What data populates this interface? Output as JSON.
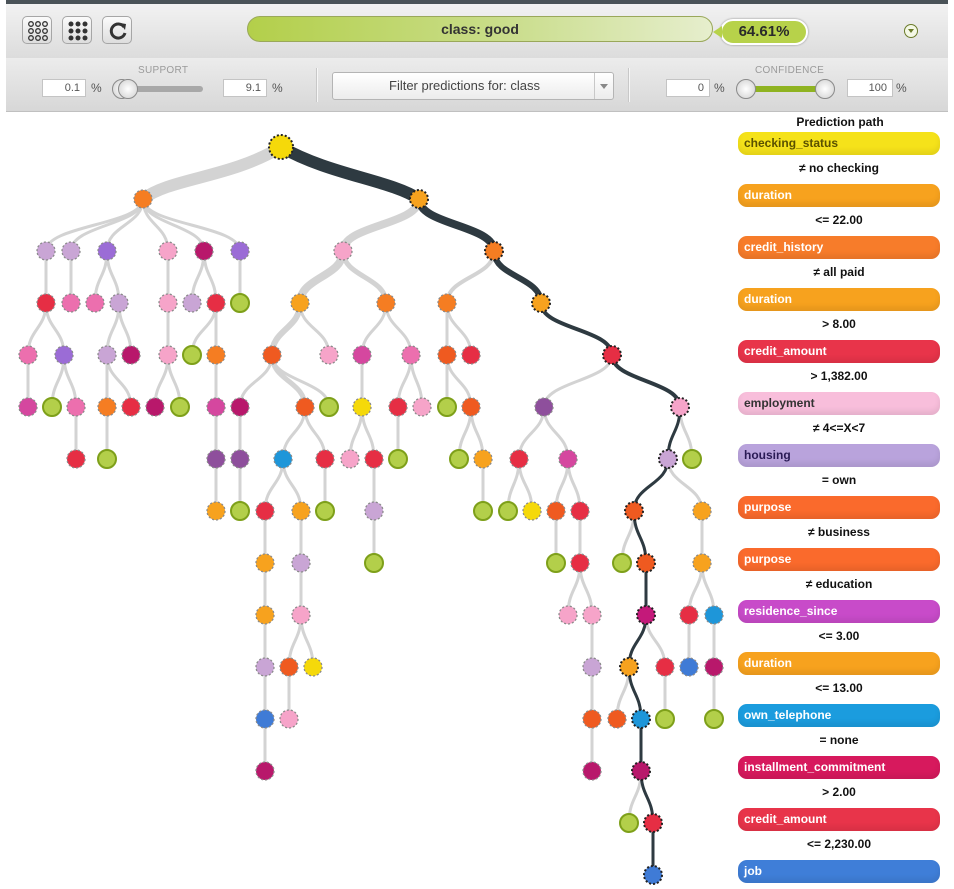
{
  "toolbar": {
    "prediction_label": "class: good",
    "confidence_value": "64.61%"
  },
  "controls": {
    "support_label": "SUPPORT",
    "support_min": "0.1",
    "support_max": "9.1",
    "support_unit": "%",
    "filter_label": "Filter predictions for: class",
    "confidence_label": "CONFIDENCE",
    "confidence_min": "0",
    "confidence_max": "100",
    "confidence_unit": "%"
  },
  "path_panel": {
    "title": "Prediction path",
    "steps": [
      {
        "field": "checking_status",
        "color": "#f5e21a",
        "text_color": "#5a5100"
      },
      {
        "condition": "≠ no checking"
      },
      {
        "field": "duration",
        "color": "#f7a21e",
        "text_color": "#ffffff"
      },
      {
        "condition": "<= 22.00"
      },
      {
        "field": "credit_history",
        "color": "#f77c2a",
        "text_color": "#ffffff"
      },
      {
        "condition": "≠ all paid"
      },
      {
        "field": "duration",
        "color": "#f7a21e",
        "text_color": "#ffffff"
      },
      {
        "condition": "> 8.00"
      },
      {
        "field": "credit_amount",
        "color": "#e8344a",
        "text_color": "#ffffff"
      },
      {
        "condition": "> 1,382.00"
      },
      {
        "field": "employment",
        "color": "#f8bedb",
        "text_color": "#333333"
      },
      {
        "condition": "≠ 4<=X<7"
      },
      {
        "field": "housing",
        "color": "#b9a3dc",
        "text_color": "#2a1a55"
      },
      {
        "condition": "= own"
      },
      {
        "field": "purpose",
        "color": "#fa6a2c",
        "text_color": "#ffffff"
      },
      {
        "condition": "≠ business"
      },
      {
        "field": "purpose",
        "color": "#fa6a2c",
        "text_color": "#ffffff"
      },
      {
        "condition": "≠ education"
      },
      {
        "field": "residence_since",
        "color": "#c84bc9",
        "text_color": "#ffffff"
      },
      {
        "condition": "<= 3.00"
      },
      {
        "field": "duration",
        "color": "#f7a21e",
        "text_color": "#ffffff"
      },
      {
        "condition": "<= 13.00"
      },
      {
        "field": "own_telephone",
        "color": "#1b9cde",
        "text_color": "#ffffff"
      },
      {
        "condition": "= none"
      },
      {
        "field": "installment_commitment",
        "color": "#d7195d",
        "text_color": "#ffffff"
      },
      {
        "condition": "> 2.00"
      },
      {
        "field": "credit_amount",
        "color": "#e8344a",
        "text_color": "#ffffff"
      },
      {
        "condition": "<= 2,230.00"
      },
      {
        "field": "job",
        "color": "#3f7ed8",
        "text_color": "#ffffff"
      }
    ]
  },
  "tree": {
    "colors": {
      "path": "#2e3a41",
      "edge": "#d3d3d3",
      "leaf_good": "#b3cf4a",
      "leaf_good_border": "#7ea01a"
    }
  }
}
